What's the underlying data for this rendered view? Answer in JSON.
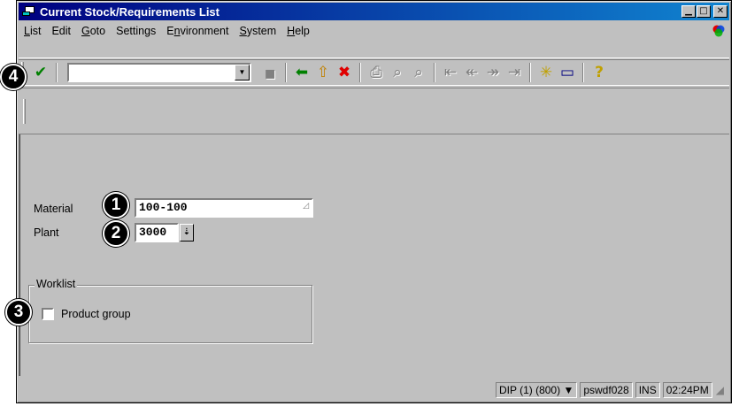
{
  "window": {
    "title": "Current Stock/Requirements List",
    "controls": {
      "minimize": "▁",
      "maximize": "□",
      "close": "✕"
    }
  },
  "menubar": {
    "items": [
      {
        "label": "List",
        "mnemonic": "L"
      },
      {
        "label": "Edit",
        "mnemonic": ""
      },
      {
        "label": "Goto",
        "mnemonic": "G"
      },
      {
        "label": "Settings",
        "mnemonic": ""
      },
      {
        "label": "Environment",
        "mnemonic": "n"
      },
      {
        "label": "System",
        "mnemonic": "S"
      },
      {
        "label": "Help",
        "mnemonic": "H"
      }
    ]
  },
  "toolbar": {
    "command_field_value": "",
    "icons": {
      "enter": "✔",
      "save": "▪",
      "back": "⬅",
      "exit": "⇧",
      "cancel": "✖",
      "print": "⎙",
      "find": "⌕",
      "find_next": "⌕",
      "first_page": "⇤",
      "prev_page": "↞",
      "next_page": "↠",
      "last_page": "⇥",
      "create_session": "✳",
      "shortcut": "▭",
      "help": "?"
    }
  },
  "form": {
    "material_label": "Material",
    "material_value": "100-100",
    "plant_label": "Plant",
    "plant_value": "3000",
    "worklist_title": "Worklist",
    "product_group_label": "Product group",
    "product_group_checked": false
  },
  "status": {
    "system": "DIP (1) (800)",
    "server": "pswdf028",
    "mode": "INS",
    "time": "02:24PM"
  },
  "callouts": {
    "c1": "1",
    "c2": "2",
    "c3": "3",
    "c4": "4"
  },
  "colors": {
    "title_gradient_start": "#000080",
    "title_gradient_end": "#1084d0",
    "enter_green": "#008000",
    "back_green": "#008000",
    "exit_yellow": "#c08000",
    "cancel_red": "#e00000",
    "help_yellow": "#c0a000"
  }
}
